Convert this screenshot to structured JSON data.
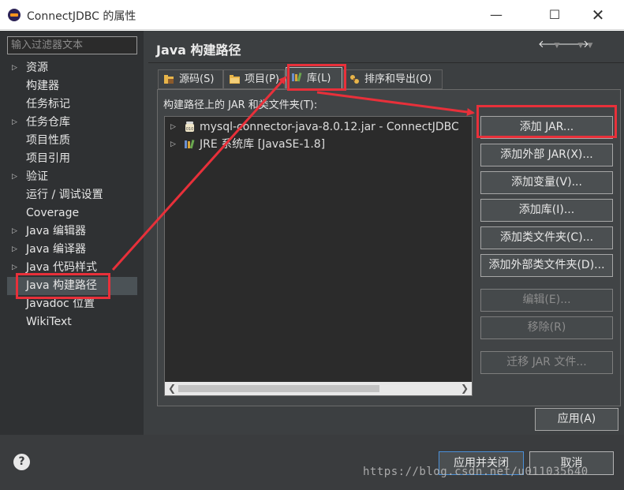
{
  "window": {
    "title": "ConnectJDBC 的属性",
    "controls": {
      "minimize": "—",
      "maximize": "☐",
      "close": "✕"
    }
  },
  "sidebar": {
    "filter_placeholder": "输入过滤器文本",
    "items": [
      {
        "label": "资源",
        "expandable": true
      },
      {
        "label": "构建器",
        "expandable": false
      },
      {
        "label": "任务标记",
        "expandable": false
      },
      {
        "label": "任务仓库",
        "expandable": true
      },
      {
        "label": "项目性质",
        "expandable": false
      },
      {
        "label": "项目引用",
        "expandable": false
      },
      {
        "label": "验证",
        "expandable": true
      },
      {
        "label": "运行 / 调试设置",
        "expandable": false
      },
      {
        "label": "Coverage",
        "expandable": false
      },
      {
        "label": "Java 编辑器",
        "expandable": true
      },
      {
        "label": "Java 编译器",
        "expandable": true
      },
      {
        "label": "Java 代码样式",
        "expandable": true
      },
      {
        "label": "Java 构建路径",
        "expandable": false,
        "selected": true
      },
      {
        "label": "Javadoc 位置",
        "expandable": false
      },
      {
        "label": "WikiText",
        "expandable": false
      }
    ]
  },
  "header": {
    "title": "Java 构建路径",
    "back_icon": "arrow-left-icon",
    "forward_icon": "arrow-right-icon",
    "menu_icon": "chevron-down-icon"
  },
  "tabs": [
    {
      "label": "源码(S)",
      "icon": "source-folder-icon"
    },
    {
      "label": "项目(P)",
      "icon": "project-folder-icon"
    },
    {
      "label": "库(L)",
      "icon": "library-icon",
      "active": true
    },
    {
      "label": "排序和导出(O)",
      "icon": "order-export-icon"
    }
  ],
  "libraries": {
    "label": "构建路径上的 JAR 和类文件夹(T):",
    "entries": [
      {
        "label": "mysql-connector-java-8.0.12.jar - ConnectJDBC",
        "icon": "jar-icon"
      },
      {
        "label": "JRE 系统库 [JavaSE-1.8]",
        "icon": "library-icon"
      }
    ]
  },
  "actions": [
    {
      "label": "添加 JAR...",
      "enabled": true
    },
    {
      "label": "添加外部 JAR(X)...",
      "enabled": true
    },
    {
      "label": "添加变量(V)...",
      "enabled": true
    },
    {
      "label": "添加库(I)...",
      "enabled": true
    },
    {
      "label": "添加类文件夹(C)...",
      "enabled": true
    },
    {
      "label": "添加外部类文件夹(D)...",
      "enabled": true
    },
    {
      "label": "编辑(E)...",
      "enabled": false
    },
    {
      "label": "移除(R)",
      "enabled": false
    },
    {
      "label": "迁移 JAR 文件...",
      "enabled": false
    }
  ],
  "apply_label": "应用(A)",
  "footer": {
    "help": "?",
    "ok_label": "应用并关闭",
    "cancel_label": "取消"
  },
  "watermark": "https://blog.csdn.net/u011035640",
  "colors": {
    "annotation": "#e8303a",
    "selection": "#4b5256",
    "dark_panel": "#3c3f41"
  }
}
